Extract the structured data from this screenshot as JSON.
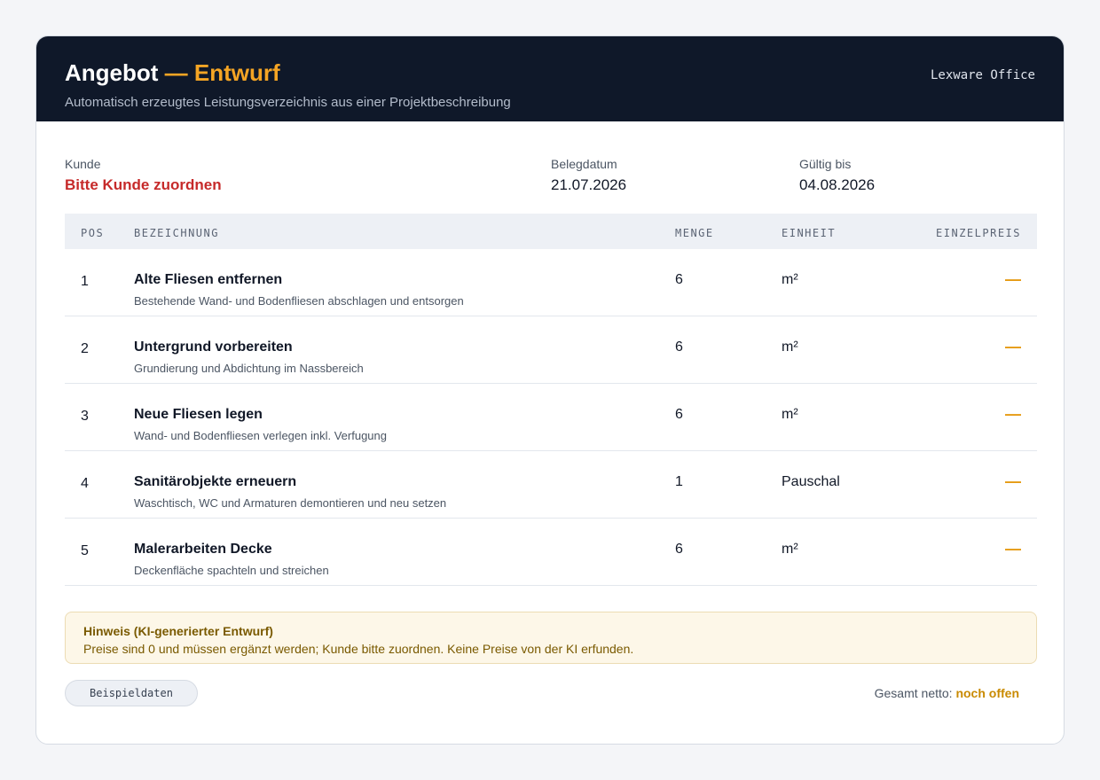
{
  "header": {
    "title": "Angebot",
    "title_dash": "—",
    "title_accent": "Entwurf",
    "subtitle": "Automatisch erzeugtes Leistungsverzeichnis aus einer Projektbeschreibung",
    "brand": "Lexware Office"
  },
  "meta": {
    "customer_label": "Kunde",
    "customer_value": "Bitte Kunde zuordnen",
    "date_label": "Belegdatum",
    "date_value": "21.07.2026",
    "valid_label": "Gültig bis",
    "valid_value": "04.08.2026"
  },
  "table": {
    "columns": [
      "POS",
      "BEZEICHNUNG",
      "MENGE",
      "EINHEIT",
      "EINZELPREIS"
    ],
    "rows": [
      {
        "pos": "1",
        "name": "Alte Fliesen entfernen",
        "desc": "Bestehende Wand- und Bodenfliesen abschlagen und entsorgen",
        "qty": "6",
        "unit": "m²",
        "price": "—"
      },
      {
        "pos": "2",
        "name": "Untergrund vorbereiten",
        "desc": "Grundierung und Abdichtung im Nassbereich",
        "qty": "6",
        "unit": "m²",
        "price": "—"
      },
      {
        "pos": "3",
        "name": "Neue Fliesen legen",
        "desc": "Wand- und Bodenfliesen verlegen inkl. Verfugung",
        "qty": "6",
        "unit": "m²",
        "price": "—"
      },
      {
        "pos": "4",
        "name": "Sanitärobjekte erneuern",
        "desc": "Waschtisch, WC und Armaturen demontieren und neu setzen",
        "qty": "1",
        "unit": "Pauschal",
        "price": "—"
      },
      {
        "pos": "5",
        "name": "Malerarbeiten Decke",
        "desc": "Deckenfläche spachteln und streichen",
        "qty": "6",
        "unit": "m²",
        "price": "—"
      }
    ]
  },
  "note": {
    "title": "Hinweis (KI-generierter Entwurf)",
    "body": "Preise sind 0 und müssen ergänzt werden; Kunde bitte zuordnen. Keine Preise von der KI erfunden."
  },
  "footer": {
    "badge": "Beispieldaten",
    "total_label": "Gesamt netto:",
    "total_value": "noch offen"
  },
  "colors": {
    "header_bg": "#0f1829",
    "accent": "#f5a524",
    "warning_red": "#c62a2a",
    "price_placeholder": "#e69a12"
  }
}
